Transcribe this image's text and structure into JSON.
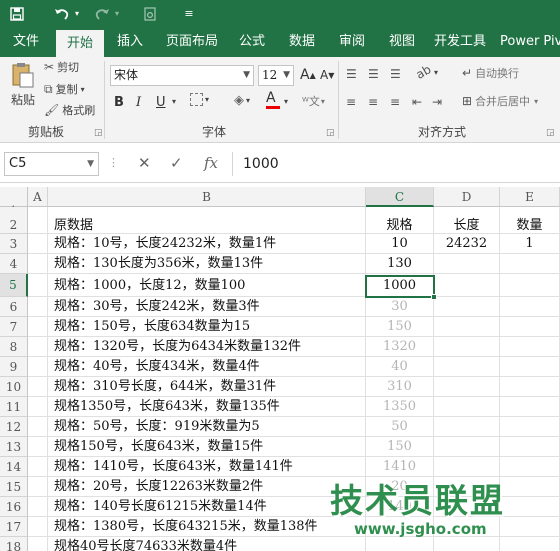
{
  "quick_access": {
    "save_icon": "save-icon",
    "undo_icon": "undo-icon",
    "redo_icon": "redo-icon",
    "preview_icon": "print-preview-icon",
    "more_icon": "customize-icon"
  },
  "tabs": [
    "文件",
    "开始",
    "插入",
    "页面布局",
    "公式",
    "数据",
    "审阅",
    "视图",
    "开发工具",
    "Power Piv"
  ],
  "active_tab": "开始",
  "ribbon": {
    "clipboard": {
      "paste": "粘贴",
      "cut": "剪切",
      "copy": "复制",
      "format_painter": "格式刷",
      "label": "剪贴板"
    },
    "font": {
      "name": "宋体",
      "size": "12",
      "grow": "A",
      "shrink": "A",
      "bold": "B",
      "italic": "I",
      "underline": "U",
      "color_glyph": "A",
      "label": "字体"
    },
    "alignment": {
      "wrap": "自动换行",
      "merge": "合并后居中",
      "label": "对齐方式"
    }
  },
  "formula_bar": {
    "name_box": "C5",
    "cancel": "✕",
    "confirm": "✓",
    "fx": "fx",
    "value": "1000"
  },
  "columns": [
    "A",
    "B",
    "C",
    "D",
    "E"
  ],
  "selected_column": "C",
  "selected_row": "5",
  "rows": [
    {
      "n": "1",
      "b": "",
      "c": "",
      "d": "",
      "e": ""
    },
    {
      "n": "2",
      "b": "原数据",
      "c": "规格",
      "d": "长度",
      "e": "数量"
    },
    {
      "n": "3",
      "b": "规格：10号，长度24232米，数量1件",
      "c": "10",
      "d": "24232",
      "e": "1"
    },
    {
      "n": "4",
      "b": "规格：130长度为356米，数量13件",
      "c": "130",
      "d": "",
      "e": ""
    },
    {
      "n": "5",
      "b": "规格：1000，长度12，数量100",
      "c": "1000",
      "d": "",
      "e": ""
    },
    {
      "n": "6",
      "b": "规格：30号，长度242米，数量3件",
      "c": "30",
      "d": "",
      "e": ""
    },
    {
      "n": "7",
      "b": "规格：150号，长度634数量为15",
      "c": "150",
      "d": "",
      "e": ""
    },
    {
      "n": "8",
      "b": "规格：1320号，长度为6434米数量132件",
      "c": "1320",
      "d": "",
      "e": ""
    },
    {
      "n": "9",
      "b": "规格：40号，长度434米，数量4件",
      "c": "40",
      "d": "",
      "e": ""
    },
    {
      "n": "10",
      "b": "规格：310号长度，644米，数量31件",
      "c": "310",
      "d": "",
      "e": ""
    },
    {
      "n": "11",
      "b": "规格1350号，长度643米，数量135件",
      "c": "1350",
      "d": "",
      "e": ""
    },
    {
      "n": "12",
      "b": "规格：50号，长度：919米数量为5",
      "c": "50",
      "d": "",
      "e": ""
    },
    {
      "n": "13",
      "b": "规格150号，长度643米，数量15件",
      "c": "150",
      "d": "",
      "e": ""
    },
    {
      "n": "14",
      "b": "规格：1410号，长度643米，数量141件",
      "c": "1410",
      "d": "",
      "e": ""
    },
    {
      "n": "15",
      "b": "规格：20号，长度12263米数量2件",
      "c": "20",
      "d": "",
      "e": ""
    },
    {
      "n": "16",
      "b": "规格：140号长度61215米数量14件",
      "c": "140",
      "d": "",
      "e": ""
    },
    {
      "n": "17",
      "b": "规格：1380号，长度643215米，数量138件",
      "c": "",
      "d": "",
      "e": ""
    },
    {
      "n": "18",
      "b": "规格40号长度74633米数量4件",
      "c": "",
      "d": "",
      "e": ""
    }
  ],
  "watermark": {
    "title": "技术员联盟",
    "url": "www.jsgho.com"
  },
  "colors": {
    "excel_green": "#217346",
    "ghost_text": "#b5b5b5",
    "watermark": "#2f8f4e"
  }
}
